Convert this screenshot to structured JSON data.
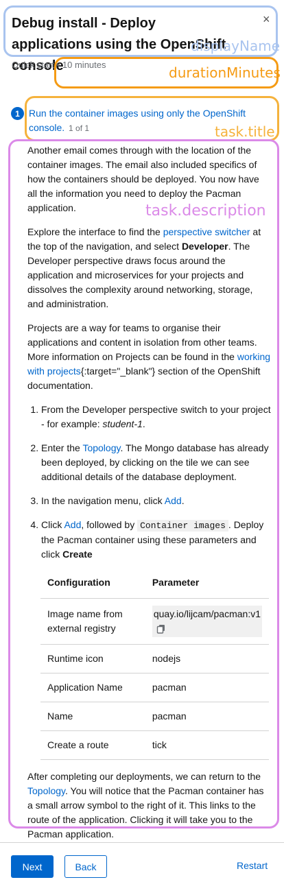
{
  "header": {
    "title": "Debug install - Deploy applications using the OpenShift console",
    "close_symbol": "×",
    "close_icon": "close-icon",
    "meta": "Quick start • 10 minutes"
  },
  "annotations": {
    "display_name": {
      "label": "displayName",
      "color": "#a9c4ef"
    },
    "duration": {
      "label": "durationMinutes",
      "color": "#f59b14"
    },
    "task_title": {
      "label": "task.title",
      "color": "#f5b23c"
    },
    "task_description": {
      "label": "task.description",
      "color": "#db8ae8"
    }
  },
  "task": {
    "number": "1",
    "title": "Run the container images using only the OpenShift console.",
    "count": "1 of 1",
    "para1": "Another email comes through with the location of the container images. The email also included specifics of how the containers should be deployed. You now have all the information you need to deploy the Pacman application.",
    "para2_a": "Explore the interface to find the ",
    "para2_link": "perspective switcher",
    "para2_b": " at the top of the navigation, and select ",
    "para2_bold": "Developer",
    "para2_c": ". The Developer perspective draws focus around the application and microservices for your projects and dissolves the complexity around networking, storage, and administration.",
    "para3_a": "Projects are a way for teams to organise their applications and content in isolation from other teams. More information on Projects can be found in the ",
    "para3_link": "working with projects",
    "para3_b": "{:target=\"_blank\"} section of the OpenShift documentation.",
    "step1_a": "From the Developer perspective switch to your project - for example: ",
    "step1_em": "student-1",
    "step1_b": ".",
    "step2_a": "Enter the ",
    "step2_link": "Topology",
    "step2_b": ". The Mongo database has already been deployed, by clicking on the tile we can see additional details of the database deployment.",
    "step3_a": "In the navigation menu, click ",
    "step3_link": "Add",
    "step3_b": ".",
    "step4_a": "Click ",
    "step4_link": "Add",
    "step4_b": ", followed by ",
    "step4_code": "Container images",
    "step4_c": ". Deploy the Pacman container using these parameters and click ",
    "step4_bold": "Create",
    "table": {
      "headers": [
        "Configuration",
        "Parameter"
      ],
      "rows": [
        [
          "Image name from external registry",
          "quay.io/lijcam/pacman:v1"
        ],
        [
          "Runtime icon",
          "nodejs"
        ],
        [
          "Application Name",
          "pacman"
        ],
        [
          "Name",
          "pacman"
        ],
        [
          "Create a route",
          "tick"
        ]
      ],
      "copy_icon": "copy-icon"
    },
    "para4_a": "After completing our deployments, we can return to the ",
    "para4_link": "Topology",
    "para4_b": ". You will notice that the Pacman container has a small arrow symbol to the right of it. This links to the route of the application. Clicking it will take you to the Pacman application."
  },
  "footer": {
    "next_label": "Next",
    "back_label": "Back",
    "restart_label": "Restart"
  }
}
